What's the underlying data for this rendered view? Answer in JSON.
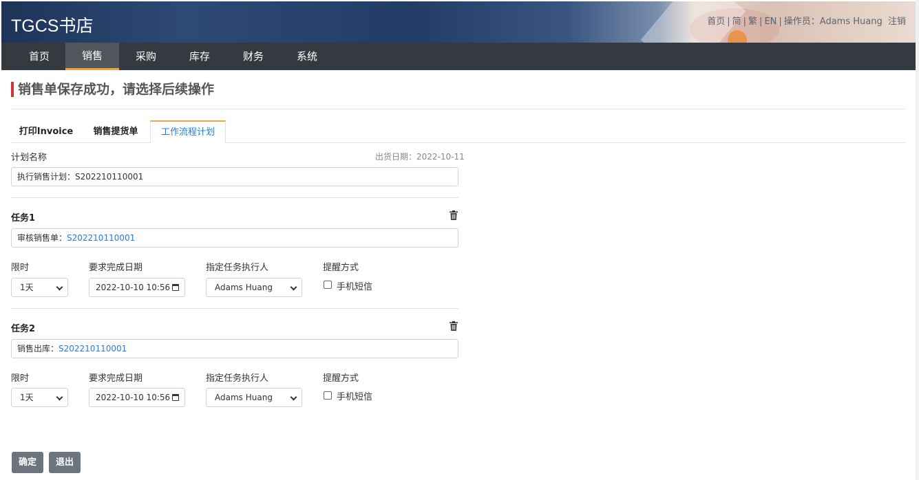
{
  "header": {
    "brand": "TGCS书店",
    "links": [
      "首页",
      "简",
      "繁",
      "EN"
    ],
    "operator_label": "操作员：Adams Huang",
    "logout": "注销"
  },
  "nav": {
    "items": [
      "首页",
      "销售",
      "采购",
      "库存",
      "财务",
      "系统"
    ],
    "active": "销售"
  },
  "page": {
    "title": "销售单保存成功，请选择后续操作"
  },
  "tabs": [
    "打印Invoice",
    "销售提货单",
    "工作流程计划"
  ],
  "plan": {
    "name_label": "计划名称",
    "ship_date": "出货日期：2022-10-11",
    "name_value": "执行销售计划：S202210110001"
  },
  "tasks": [
    {
      "title": "任务1",
      "desc_prefix": "审核销售单：",
      "desc_link": "S202210110001",
      "limit_label": "限时",
      "limit_value": "1天",
      "due_label": "要求完成日期",
      "due_value": "2022-10-10 10:56",
      "assignee_label": "指定任务执行人",
      "assignee_value": "Adams Huang",
      "remind_label": "提醒方式",
      "remind_option": "手机短信"
    },
    {
      "title": "任务2",
      "desc_prefix": "销售出库：",
      "desc_link": "S202210110001",
      "limit_label": "限时",
      "limit_value": "1天",
      "due_label": "要求完成日期",
      "due_value": "2022-10-10 10:56",
      "assignee_label": "指定任务执行人",
      "assignee_value": "Adams Huang",
      "remind_label": "提醒方式",
      "remind_option": "手机短信"
    }
  ],
  "buttons": {
    "confirm": "确定",
    "exit": "退出"
  },
  "colors": {
    "nav_bg": "#343a40",
    "accent": "#f0a44a",
    "title_bar": "#d0343b",
    "link": "#2a7bd0",
    "button": "#6c757d"
  }
}
